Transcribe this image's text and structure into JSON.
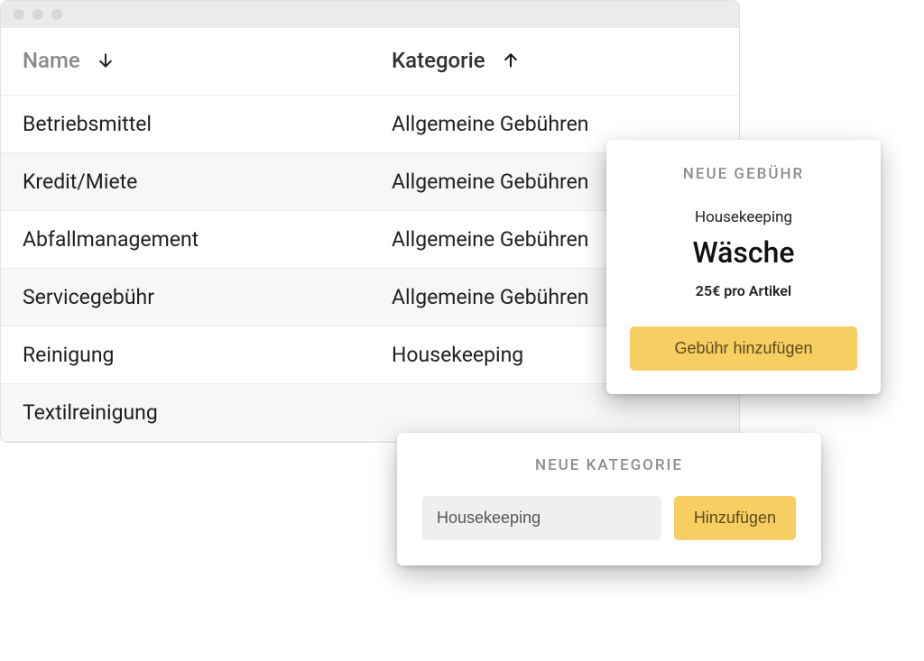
{
  "columns": {
    "name": "Name",
    "category": "Kategorie"
  },
  "rows": [
    {
      "name": "Betriebsmittel",
      "category": "Allgemeine Gebühren"
    },
    {
      "name": "Kredit/Miete",
      "category": "Allgemeine Gebühren"
    },
    {
      "name": "Abfallmanagement",
      "category": "Allgemeine Gebühren"
    },
    {
      "name": "Servicegebühr",
      "category": "Allgemeine Gebühren"
    },
    {
      "name": "Reinigung",
      "category": "Housekeeping"
    },
    {
      "name": "Textilreinigung",
      "category": ""
    }
  ],
  "feeCard": {
    "title": "NEUE GEBÜHR",
    "category": "Housekeeping",
    "name": "Wäsche",
    "price": "25€ pro Artikel",
    "button": "Gebühr hinzufügen"
  },
  "categoryCard": {
    "title": "NEUE KATEGORIE",
    "inputValue": "Housekeeping",
    "button": "Hinzufügen"
  },
  "colors": {
    "accent": "#f7ce62"
  }
}
